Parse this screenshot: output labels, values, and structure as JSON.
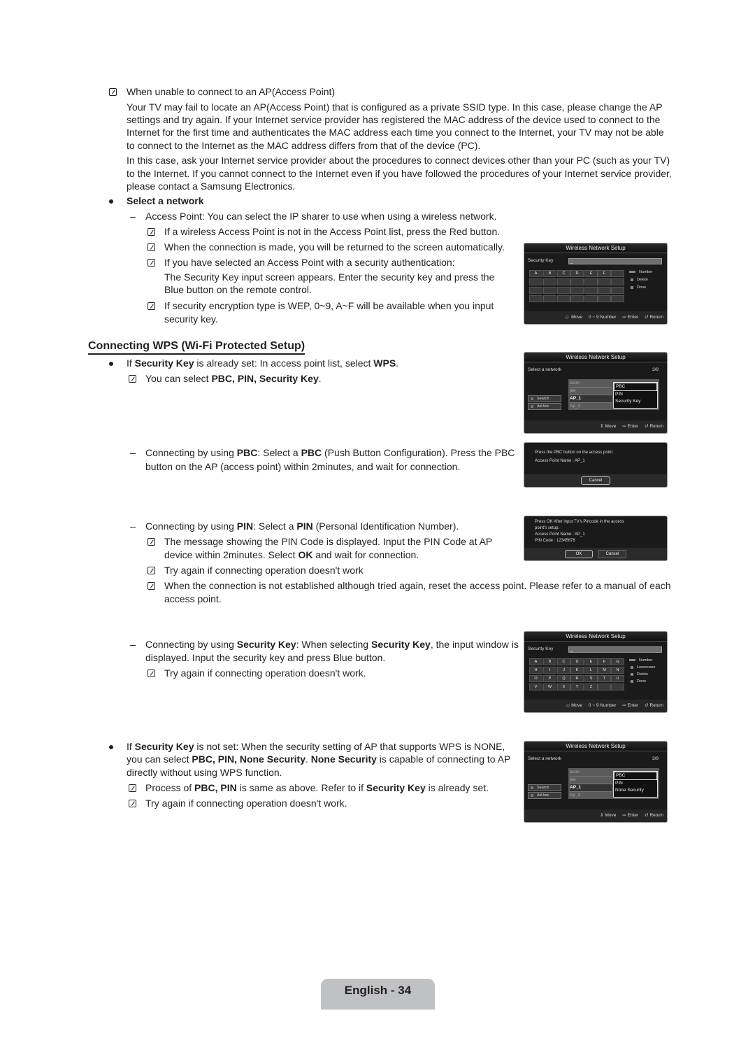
{
  "section_unable": {
    "heading": "When unable to connect to an AP(Access Point)",
    "para1_lines": [
      "Your TV may fail to locate an AP(Access Point) that is configured as a private SSID type. In this case, please change the AP",
      "settings and try again. If your Internet service provider has registered the MAC address of the device used to connect to the",
      "Internet for the first time and authenticates the MAC address each time you connect to the Internet, your TV may not be able",
      "to connect to the Internet as the MAC address differs from that of the device (PC)."
    ],
    "para2_lines": [
      "In this case, ask your Internet service provider about the procedures to connect devices other than your PC (such as your TV)",
      "to the Internet. If you cannot connect to the Internet even if you have followed the procedures of your Internet service provider,",
      "please contact a Samsung Electronics."
    ]
  },
  "select_network": {
    "bullet": "Select a network",
    "dash": "Access Point: You can select the IP sharer to use when using a wireless network.",
    "note1": "If a wireless Access Point is not in the Access Point list, press the Red button.",
    "note2": "When the connection is made, you will be returned to the screen automatically.",
    "note3": "If you have selected an Access Point with a security authentication:",
    "note3_cont1": "The Security Key input screen appears. Enter the security key and press the",
    "note3_cont2": "Blue button on the remote control.",
    "note4_line1": "If security encryption type is WEP, 0~9, A~F will be available when you input",
    "note4_line2": "security key."
  },
  "wps": {
    "title": "Connecting WPS (Wi-Fi Protected Setup)",
    "bullet1": {
      "pre": "If ",
      "b1": "Security Key",
      "mid": " is already set: In access point list, select ",
      "b2": "WPS",
      "post": "."
    },
    "note_select": {
      "pre": "You can select ",
      "b": "PBC, PIN, Security Key",
      "post": "."
    },
    "pbc": {
      "line1_pre": "Connecting by using ",
      "line1_b1": "PBC",
      "line1_mid": ": Select a ",
      "line1_b2": "PBC",
      "line1_post": " (Push Button Configuration). Press the PBC",
      "line2": "button on the AP (access point) within 2minutes, and wait for connection."
    },
    "pin": {
      "line1_pre": "Connecting by using ",
      "line1_b1": "PIN",
      "line1_mid": ": Select a ",
      "line1_b2": "PIN",
      "line1_post": " (Personal Identification Number).",
      "note1_line1": "The message showing the PIN Code is displayed. Input the PIN Code at AP",
      "note1_line2_pre": "device within 2minutes. Select ",
      "note1_line2_b": "OK",
      "note1_line2_post": " and wait for connection.",
      "note2": "Try again if connecting operation doesn't work",
      "note3_line1": "When the connection is not established although tried again, reset the access point. Please refer to a manual of each",
      "note3_line2": "access point."
    },
    "seckey": {
      "line1_pre": "Connecting by using ",
      "line1_b1": "Security Key",
      "line1_mid": ": When selecting ",
      "line1_b2": "Security Key",
      "line1_post": ", the input window is",
      "line2": "displayed. Input the security key and press Blue button.",
      "note": "Try again if connecting operation doesn't work."
    },
    "bullet2": {
      "line1_pre": "If ",
      "line1_b": "Security Key",
      "line1_post": " is not set: When the security setting of AP that supports WPS is NONE,",
      "line2_pre": "you can select ",
      "line2_b1": "PBC, PIN, None Security",
      "line2_mid": ". ",
      "line2_b2": "None Security",
      "line2_post": " is capable of connecting to AP",
      "line3": "directly without using WPS function.",
      "note1_pre": "Process of ",
      "note1_b1": "PBC, PIN",
      "note1_mid": " is same as above. Refer to if ",
      "note1_b2": "Security Key",
      "note1_post": " is already set.",
      "note2": "Try again if connecting operation doesn't work."
    }
  },
  "screens": {
    "title": "Wireless Network Setup",
    "security_key_label": "Security Key",
    "security_key_value": "_",
    "hex_keys": [
      "A",
      "B",
      "C",
      "D",
      "E",
      "F"
    ],
    "full_keys": [
      "A",
      "B",
      "C",
      "D",
      "E",
      "F",
      "G",
      "H",
      "I",
      "J",
      "K",
      "L",
      "M",
      "N",
      "O",
      "P",
      "Q",
      "R",
      "S",
      "T",
      "U",
      "V",
      "W",
      "X",
      "Y",
      "Z"
    ],
    "side_number": "Number",
    "side_lowercase": "Lowercase",
    "side_delete": "Delete",
    "side_done": "Done",
    "footer_move": "Move",
    "footer_number": "0 ~ 9 Number",
    "footer_enter": "Enter",
    "footer_return": "Return",
    "select_network_label": "Select a network",
    "page_indicator": "3/9",
    "networks": [
      "sson",
      "jee",
      "AP_1",
      "Ap_2"
    ],
    "search_btn": "Search",
    "adhoc_btn": "Ad-hoc",
    "wps_options_a": [
      "PBC",
      "PIN",
      "Security Key"
    ],
    "wps_options_b": [
      "PBC",
      "PIN",
      "None Security"
    ],
    "pbc_msg1": "Press the PBC button on the access point.",
    "pbc_msg2": "Access Point Name : AP_1",
    "cancel_btn": "Cancel",
    "pin_msg1": "Press OK After input TV's Pincode in the access",
    "pin_msg2": "point's setup.",
    "pin_msg3": "Access Point Name : AP_1",
    "pin_msg4": "PIN Code : 12345678",
    "ok_btn": "OK"
  },
  "footer": {
    "page_label": "English - 34"
  }
}
